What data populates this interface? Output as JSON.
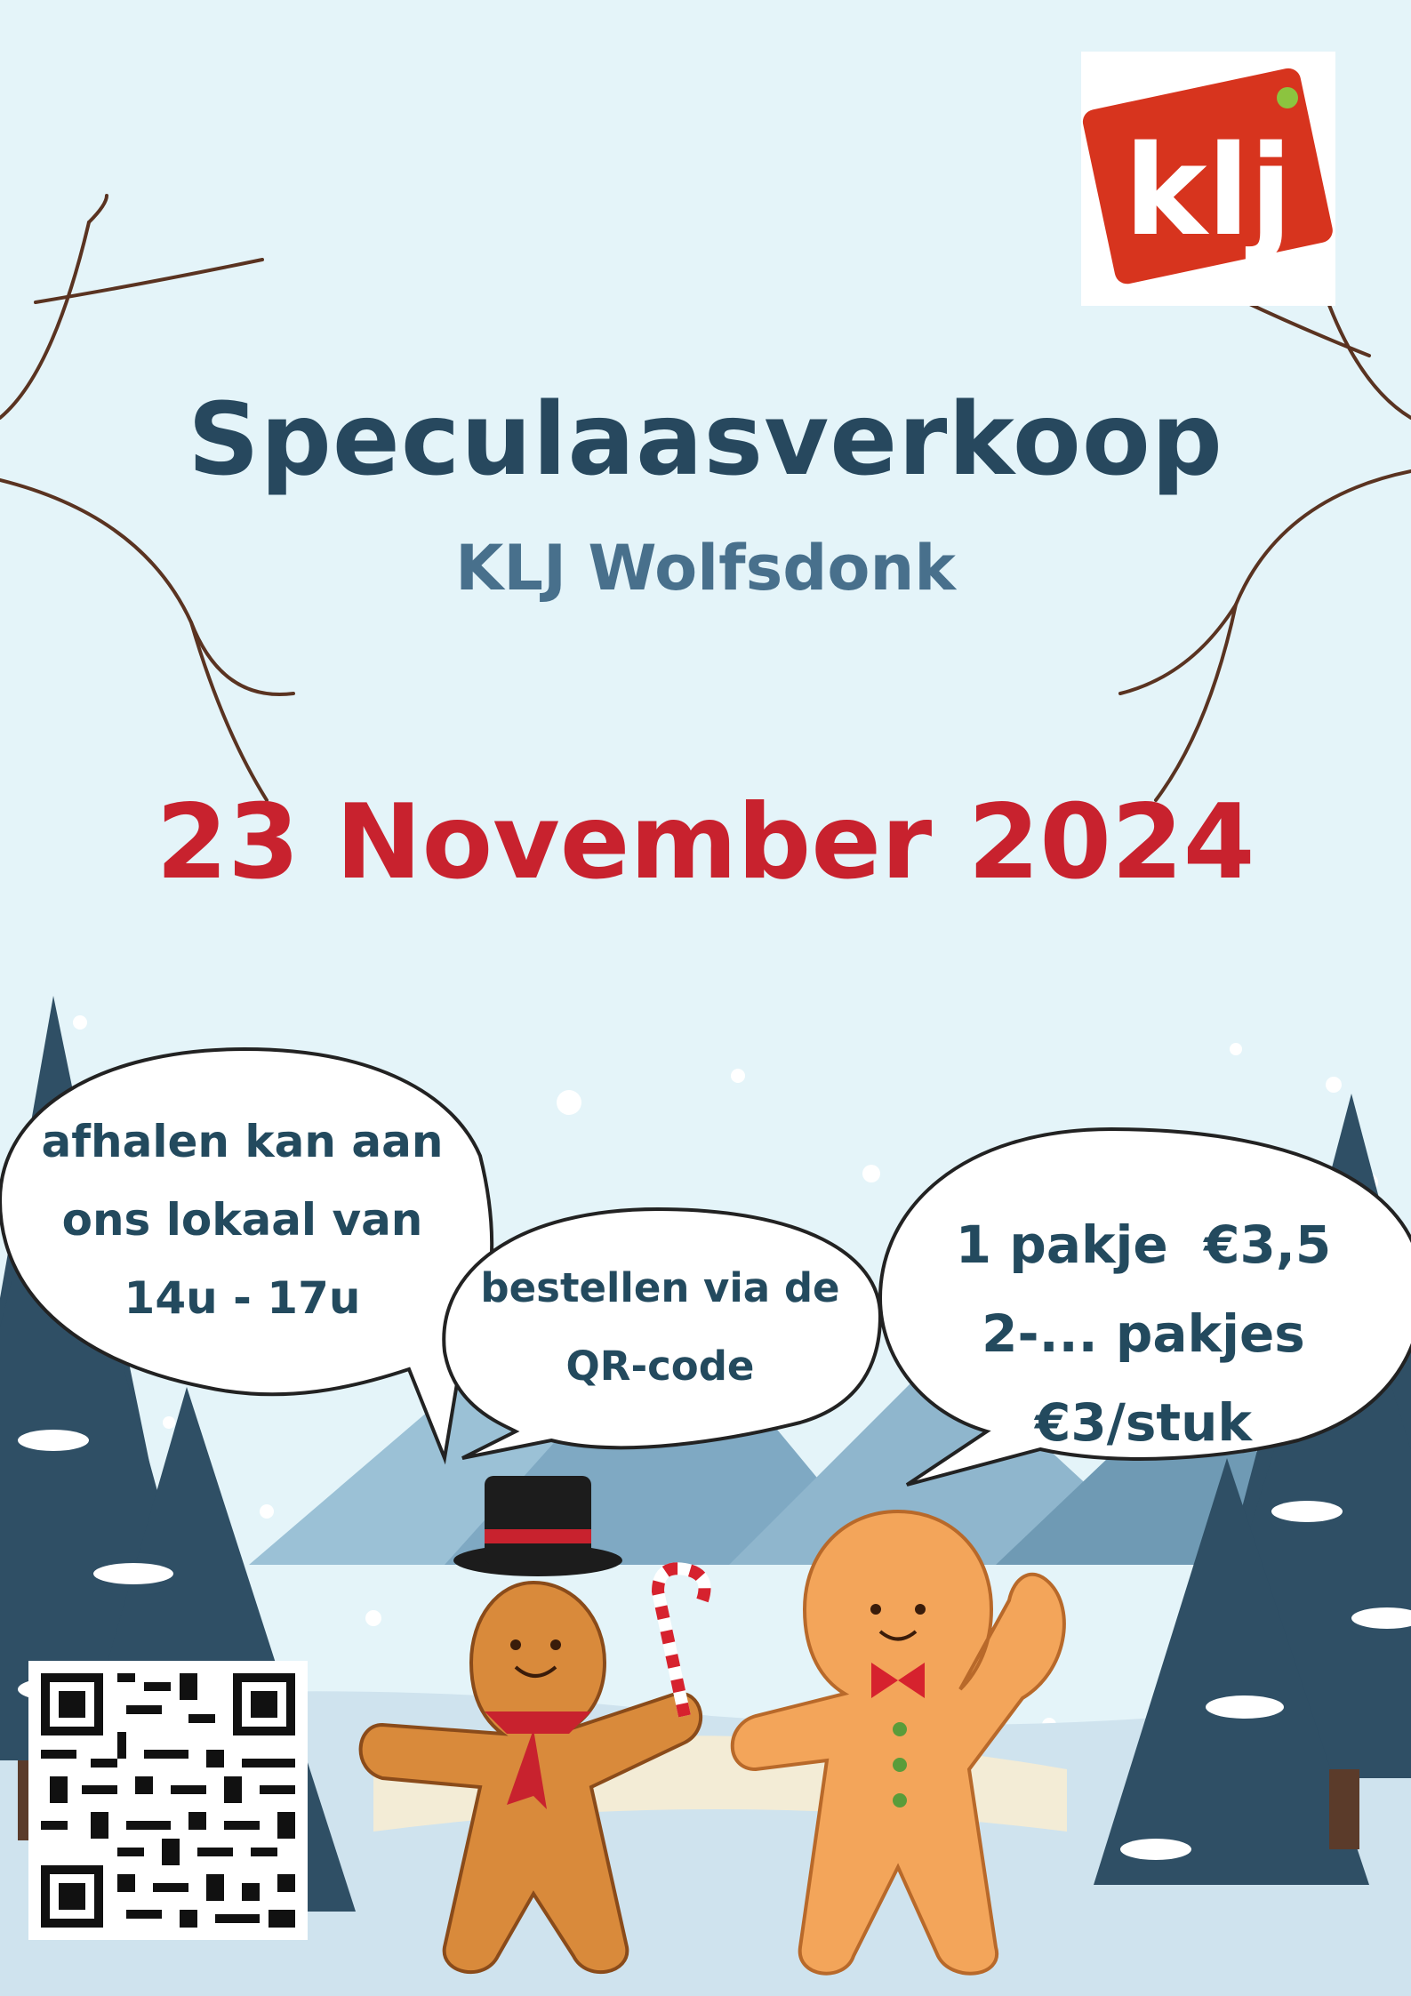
{
  "poster": {
    "title": "Speculaasverkoop",
    "subtitle": "KLJ Wolfsdonk",
    "date": "23 November 2024"
  },
  "logo": {
    "text": "klj",
    "color": "#d7341e",
    "dot_color": "#8cc43f"
  },
  "bubbles": {
    "pickup": [
      "afhalen kan aan",
      "ons lokaal van",
      "14u - 17u"
    ],
    "order": [
      "bestellen via de",
      "QR-code"
    ],
    "price": [
      "1 pakje  €3,5",
      "2-... pakjes €3/stuk"
    ]
  },
  "colors": {
    "background": "#e4f4f9",
    "title": "#27485e",
    "subtitle": "#48708c",
    "date": "#c8222e",
    "trees": "#2f4f65",
    "mountains": "#6f9ab4"
  },
  "icons": [
    "klj-logo",
    "qr-code-icon",
    "gingerbread-man-icon",
    "snowflake-icon",
    "tree-branch-icon"
  ]
}
